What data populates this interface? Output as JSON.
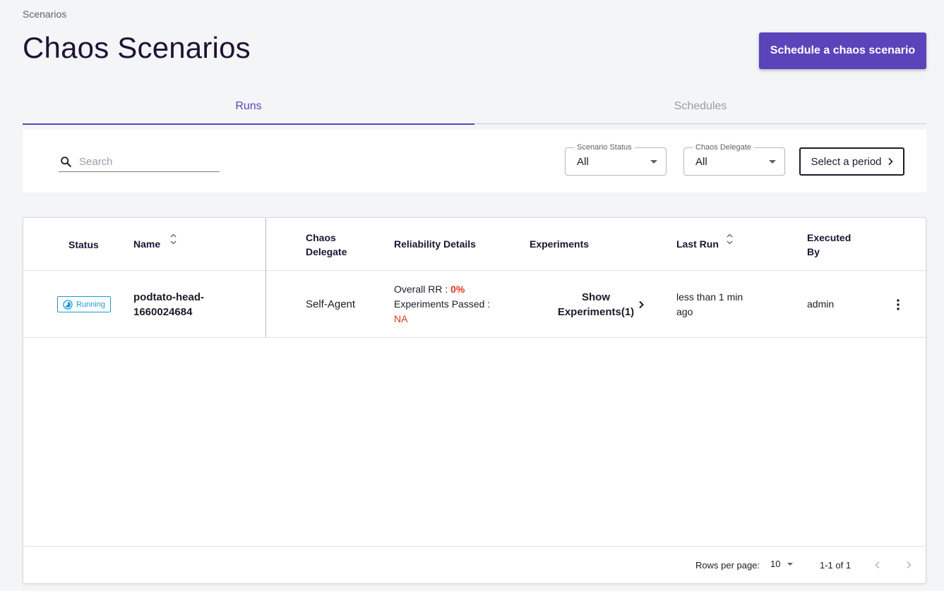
{
  "breadcrumb": "Scenarios",
  "page_title": "Chaos Scenarios",
  "schedule_button": "Schedule a chaos scenario",
  "tabs": [
    {
      "label": "Runs",
      "active": true
    },
    {
      "label": "Schedules",
      "active": false
    }
  ],
  "toolbar": {
    "search_placeholder": "Search",
    "scenario_status": {
      "legend": "Scenario Status",
      "value": "All"
    },
    "chaos_delegate": {
      "legend": "Chaos Delegate",
      "value": "All"
    },
    "period_button": "Select a period"
  },
  "table": {
    "headers": {
      "status": "Status",
      "name": "Name",
      "chaos_delegate_1": "Chaos",
      "chaos_delegate_2": "Delegate",
      "reliability": "Reliability Details",
      "experiments": "Experiments",
      "last_run": "Last Run",
      "executed_by_1": "Executed",
      "executed_by_2": "By"
    },
    "rows": [
      {
        "status": "Running",
        "name_1": "podtato-head-",
        "name_2": "1660024684",
        "chaos_delegate": "Self-Agent",
        "overall_rr_label": "Overall RR : ",
        "overall_rr_value": "0%",
        "experiments_passed_label": "Experiments Passed :",
        "experiments_passed_value": "NA",
        "show_experiments_1": "Show",
        "show_experiments_2": "Experiments(1)",
        "last_run_1": "less than 1 min",
        "last_run_2": "ago",
        "executed_by": "admin"
      }
    ]
  },
  "pagination": {
    "rows_per_page_label": "Rows per page:",
    "rows_per_page_value": "10",
    "range": "1-1 of 1"
  },
  "colors": {
    "accent": "#5b44ba",
    "running": "#1a9bd7",
    "danger": "#e0341d"
  }
}
